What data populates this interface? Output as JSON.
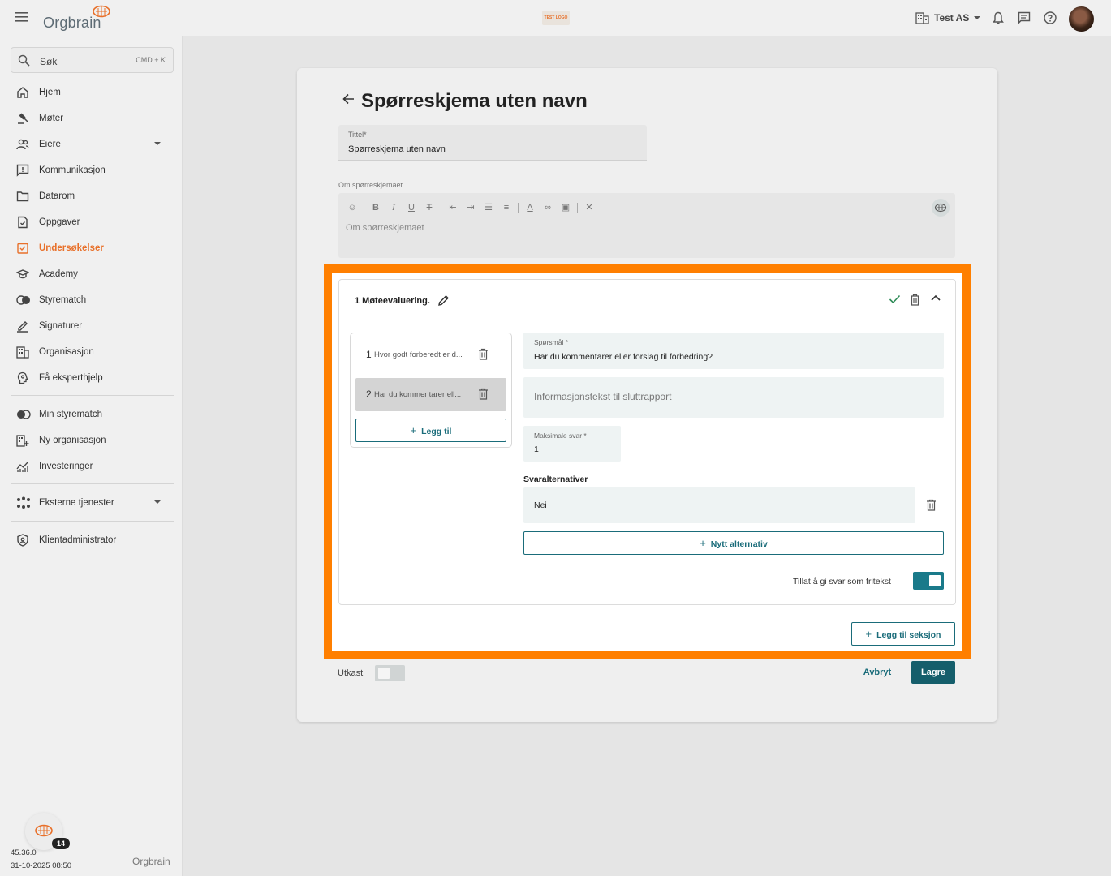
{
  "topbar": {
    "logo_text": "Orgbrain",
    "test_logo": "TEST LOGO",
    "org_name": "Test AS",
    "icons": [
      "menu-icon",
      "building-icon",
      "bell-icon",
      "chat-icon",
      "help-icon"
    ]
  },
  "sidebar": {
    "search_placeholder": "Søk",
    "search_shortcut": "CMD + K",
    "items": [
      {
        "label": "Hjem",
        "icon": "home-icon"
      },
      {
        "label": "Møter",
        "icon": "gavel-icon"
      },
      {
        "label": "Eiere",
        "icon": "people-icon"
      },
      {
        "label": "Kommunikasjon",
        "icon": "announcement-icon"
      },
      {
        "label": "Datarom",
        "icon": "folder-icon"
      },
      {
        "label": "Oppgaver",
        "icon": "task-icon"
      },
      {
        "label": "Undersøkelser",
        "icon": "survey-icon"
      },
      {
        "label": "Academy",
        "icon": "academy-icon"
      },
      {
        "label": "Styrematch",
        "icon": "match-icon"
      },
      {
        "label": "Signaturer",
        "icon": "signature-icon"
      },
      {
        "label": "Organisasjon",
        "icon": "organization-icon"
      },
      {
        "label": "Få eksperthjelp",
        "icon": "expert-icon"
      }
    ],
    "items2": [
      {
        "label": "Min styrematch",
        "icon": "match-icon"
      },
      {
        "label": "Ny organisasjon",
        "icon": "add-organization-icon"
      },
      {
        "label": "Investeringer",
        "icon": "chart-icon"
      }
    ],
    "eksterne": "Eksterne tjenester",
    "klientadmin": "Klientadministrator",
    "notification_count": "14",
    "version": "45.36.0",
    "build_date": "31-10-2025 08:50",
    "footer_logo": "Orgbrain",
    "accent": "#e8702a"
  },
  "form": {
    "back_icon": "arrow-left-icon",
    "page_title": "Spørreskjema uten navn",
    "title_label": "Tittel*",
    "title_value": "Spørreskjema uten navn",
    "about_label": "Om spørreskjemaet",
    "about_placeholder": "Om spørreskjemaet",
    "utkast_label": "Utkast",
    "cancel_label": "Avbryt",
    "save_label": "Lagre"
  },
  "section": {
    "title": "1 Møteevaluering.",
    "questions": [
      {
        "num": "1",
        "text": "Hvor godt forberedt er d..."
      },
      {
        "num": "2",
        "text": "Har du kommentarer ell..."
      }
    ],
    "add_question_label": "Legg til",
    "question_label": "Spørsmål *",
    "question_value": "Har du kommentarer eller forslag til forbedring?",
    "info_placeholder": "Informasjonstekst til sluttrapport",
    "max_label": "Maksimale svar *",
    "max_value": "1",
    "options_heading": "Svaralternativer",
    "options": [
      "Nei"
    ],
    "new_option_label": "Nytt alternativ",
    "freetext_label": "Tillat å gi svar som fritekst",
    "freetext_enabled": true,
    "add_section_label": "Legg til seksjon",
    "highlight_color": "#ff7f00",
    "primary_color": "#1a6c7a"
  }
}
